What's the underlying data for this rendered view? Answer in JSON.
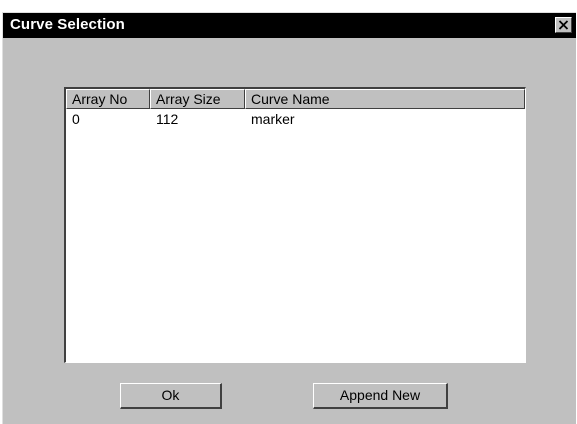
{
  "window": {
    "title": "Curve Selection",
    "close_icon": "close-icon"
  },
  "table": {
    "columns": [
      "Array No",
      "Array Size",
      "Curve Name"
    ],
    "rows": [
      [
        "0",
        "112",
        "marker"
      ]
    ]
  },
  "buttons": {
    "ok_label": "Ok",
    "append_label": "Append New"
  },
  "colors": {
    "titlebar": "#000000",
    "dialog_face": "#c0c0c0",
    "list_background": "#ffffff"
  }
}
